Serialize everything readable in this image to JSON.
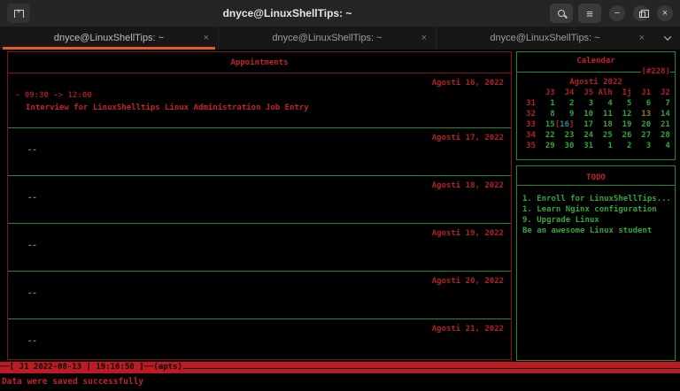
{
  "window": {
    "title": "dnyce@LinuxShellTips: ~"
  },
  "titlebar": {
    "minimize_label": "−",
    "close_label": "×",
    "menu_label": "≡"
  },
  "tabbar": {
    "active_index": 0,
    "close_label": "×",
    "tabs": [
      {
        "label": "dnyce@LinuxShellTips: ~"
      },
      {
        "label": "dnyce@LinuxShellTips: ~"
      },
      {
        "label": "dnyce@LinuxShellTips: ~"
      }
    ]
  },
  "appointments": {
    "title": "Appointments",
    "days": [
      {
        "date": "Agosti 16, 2022",
        "entries": [
          {
            "time": "- 09:30 -> 12:00",
            "desc": "Interview for LinuxShelltips Linux Administration Job Entry"
          }
        ]
      },
      {
        "date": "Agosti 17, 2022",
        "empty": "--"
      },
      {
        "date": "Agosti 18, 2022",
        "empty": "--"
      },
      {
        "date": "Agosti 19, 2022",
        "empty": "--"
      },
      {
        "date": "Agosti 20, 2022",
        "empty": "--"
      },
      {
        "date": "Agosti 21, 2022",
        "empty": "--"
      }
    ]
  },
  "calendar": {
    "title": "Calendar",
    "day_of_year": "(#228)",
    "month_year": "Agosti 2022",
    "weekday_headers": [
      "J3",
      "J4",
      "J5",
      "Alh",
      "Ij",
      "J1",
      "J2"
    ],
    "weeks": [
      {
        "num": "31",
        "days": [
          "1",
          "2",
          "3",
          "4",
          "5",
          "6",
          "7"
        ]
      },
      {
        "num": "32",
        "days": [
          "8",
          "9",
          "10",
          "11",
          "12",
          "13",
          "14"
        ]
      },
      {
        "num": "33",
        "days": [
          "15",
          "16",
          "17",
          "18",
          "19",
          "20",
          "21"
        ]
      },
      {
        "num": "34",
        "days": [
          "22",
          "23",
          "24",
          "25",
          "26",
          "27",
          "28"
        ]
      },
      {
        "num": "35",
        "days": [
          "29",
          "30",
          "31",
          "1",
          "2",
          "3",
          "4"
        ]
      }
    ],
    "today": "13",
    "selected": "16"
  },
  "todo": {
    "title": "TODO",
    "items": [
      "1. Enroll for LinuxShellTips...",
      "1. Learn Nginx configuration",
      "9. Upgrade Linux",
      "Be an awesome Linux student"
    ]
  },
  "statusbar": {
    "text": "──[ J1 2022-08-13 | 19:16:50 ]──(apts)"
  },
  "message": "Data were saved successfully",
  "colors": {
    "accent_orange": "#ea5b22",
    "panel_red": "#b12025",
    "bright_red": "#c42227",
    "green": "#31a737",
    "green_border": "#218a27",
    "statusbar_red": "#bd1b24",
    "today_yellow": "#97772c",
    "selected_teal": "#2e8383"
  }
}
